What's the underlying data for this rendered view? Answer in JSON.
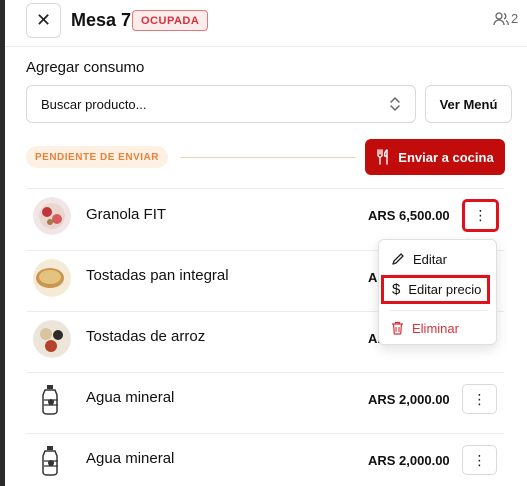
{
  "header": {
    "close_icon": "close-icon",
    "title": "Mesa 7",
    "status_badge": "OCUPADA",
    "guests_count": "2"
  },
  "consumption": {
    "section_title": "Agregar consumo",
    "search_value": "Buscar producto...",
    "menu_button": "Ver Menú"
  },
  "pending": {
    "badge": "PENDIENTE DE ENVIAR",
    "send_button": "Enviar a cocina"
  },
  "items": [
    {
      "name": "Granola FIT",
      "price": "ARS 6,500.00"
    },
    {
      "name": "Tostadas pan integral",
      "price": "AI"
    },
    {
      "name": "Tostadas de arroz",
      "price": "AI"
    },
    {
      "name": "Agua mineral",
      "price": "ARS 2,000.00"
    },
    {
      "name": "Agua mineral",
      "price": "ARS 2,000.00"
    }
  ],
  "dropdown": {
    "edit": "Editar",
    "edit_price": "Editar precio",
    "delete": "Eliminar"
  },
  "colors": {
    "accent": "#c20c0c",
    "badge_red": "#d9303a",
    "pending_orange": "#e8823a",
    "highlight": "#e0111a"
  }
}
